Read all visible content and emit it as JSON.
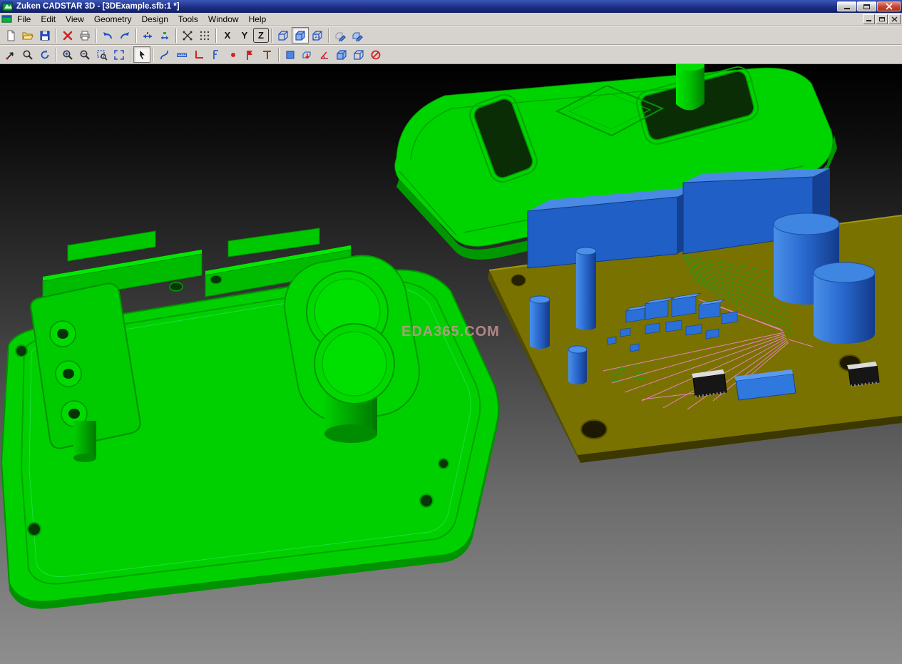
{
  "window": {
    "title": "Zuken CADSTAR 3D - [3DExample.sfb:1 *]",
    "controls": [
      "minimize",
      "maximize",
      "close"
    ]
  },
  "menu": {
    "items": [
      {
        "label": "File"
      },
      {
        "label": "Edit"
      },
      {
        "label": "View"
      },
      {
        "label": "Geometry"
      },
      {
        "label": "Design"
      },
      {
        "label": "Tools"
      },
      {
        "label": "Window"
      },
      {
        "label": "Help"
      }
    ],
    "mdi_controls": [
      "minimize",
      "restore",
      "close"
    ]
  },
  "toolbar_standard": {
    "axis": {
      "x": "X",
      "y": "Y",
      "z": "Z"
    },
    "active_axis": "Z",
    "buttons": [
      "new",
      "open",
      "save",
      "delete",
      "print",
      "undo",
      "redo",
      "measure-horizontal",
      "measure-vertical",
      "snap-point",
      "grid",
      "axis-x",
      "axis-y",
      "axis-z",
      "wireframe-view",
      "shaded-view",
      "hidden-line-view",
      "sketch-on-face",
      "sketch-3d"
    ],
    "active_view_mode": "shaded-view"
  },
  "toolbar_view": {
    "buttons": [
      "walk-mode",
      "zoom-mode",
      "orbit-mode",
      "zoom-in",
      "zoom-out",
      "zoom-window",
      "zoom-extents",
      "select",
      "spline",
      "measure-distance",
      "measure-angle",
      "dimension",
      "point",
      "datum-flag",
      "axes",
      "face-fill",
      "extrude",
      "angle-dimension",
      "solid-box",
      "assembly-box",
      "clash-check-off"
    ],
    "active_tool": "select"
  },
  "viewport": {
    "watermark": "EDA365.COM",
    "scene": {
      "models": [
        "enclosure-lid-green",
        "enclosure-base-green",
        "pcb-with-components"
      ],
      "colors": {
        "background_top": "#000000",
        "background_bottom": "#8c8c8c",
        "enclosure_green": "#00d400",
        "enclosure_green_dark": "#009200",
        "pcb_olive": "#797200",
        "component_blue": "#1f5fc6",
        "component_blue_light": "#4a8ae4",
        "trace_pink": "#ef82c8",
        "trace_green": "#1e9e1e",
        "chip_black": "#161616"
      }
    }
  }
}
